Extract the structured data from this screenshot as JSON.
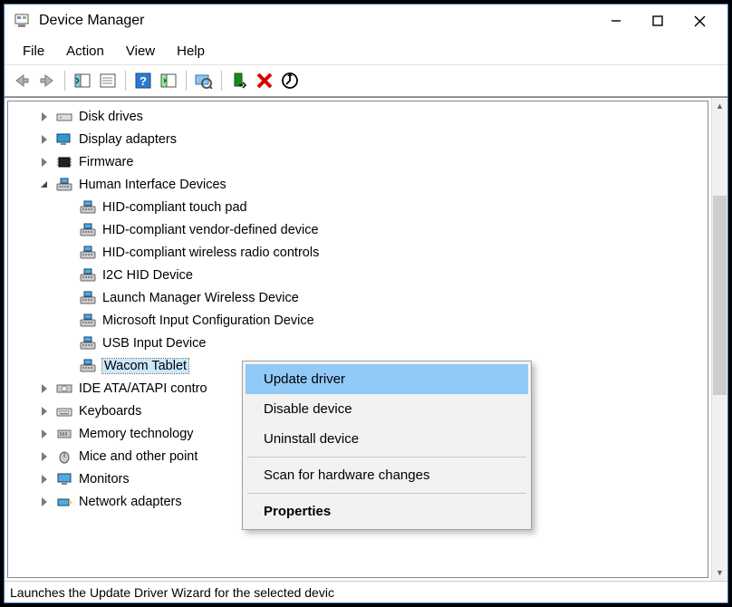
{
  "window": {
    "title": "Device Manager"
  },
  "menubar": {
    "file": "File",
    "action": "Action",
    "view": "View",
    "help": "Help"
  },
  "tree": {
    "items": [
      {
        "label": "Disk drives"
      },
      {
        "label": "Display adapters"
      },
      {
        "label": "Firmware"
      },
      {
        "label": "Human Interface Devices"
      },
      {
        "children": [
          {
            "label": "HID-compliant touch pad"
          },
          {
            "label": "HID-compliant vendor-defined device"
          },
          {
            "label": "HID-compliant wireless radio controls"
          },
          {
            "label": "I2C HID Device"
          },
          {
            "label": "Launch Manager Wireless Device"
          },
          {
            "label": "Microsoft Input Configuration Device"
          },
          {
            "label": "USB Input Device"
          },
          {
            "label": "Wacom Tablet"
          }
        ]
      },
      {
        "label": "IDE ATA/ATAPI contro"
      },
      {
        "label": "Keyboards"
      },
      {
        "label": "Memory technology"
      },
      {
        "label": "Mice and other point"
      },
      {
        "label": "Monitors"
      },
      {
        "label": "Network adapters"
      }
    ]
  },
  "context_menu": {
    "update": "Update driver",
    "disable": "Disable device",
    "uninstall": "Uninstall device",
    "scan": "Scan for hardware changes",
    "properties": "Properties"
  },
  "statusbar": {
    "text": "Launches the Update Driver Wizard for the selected devic"
  }
}
